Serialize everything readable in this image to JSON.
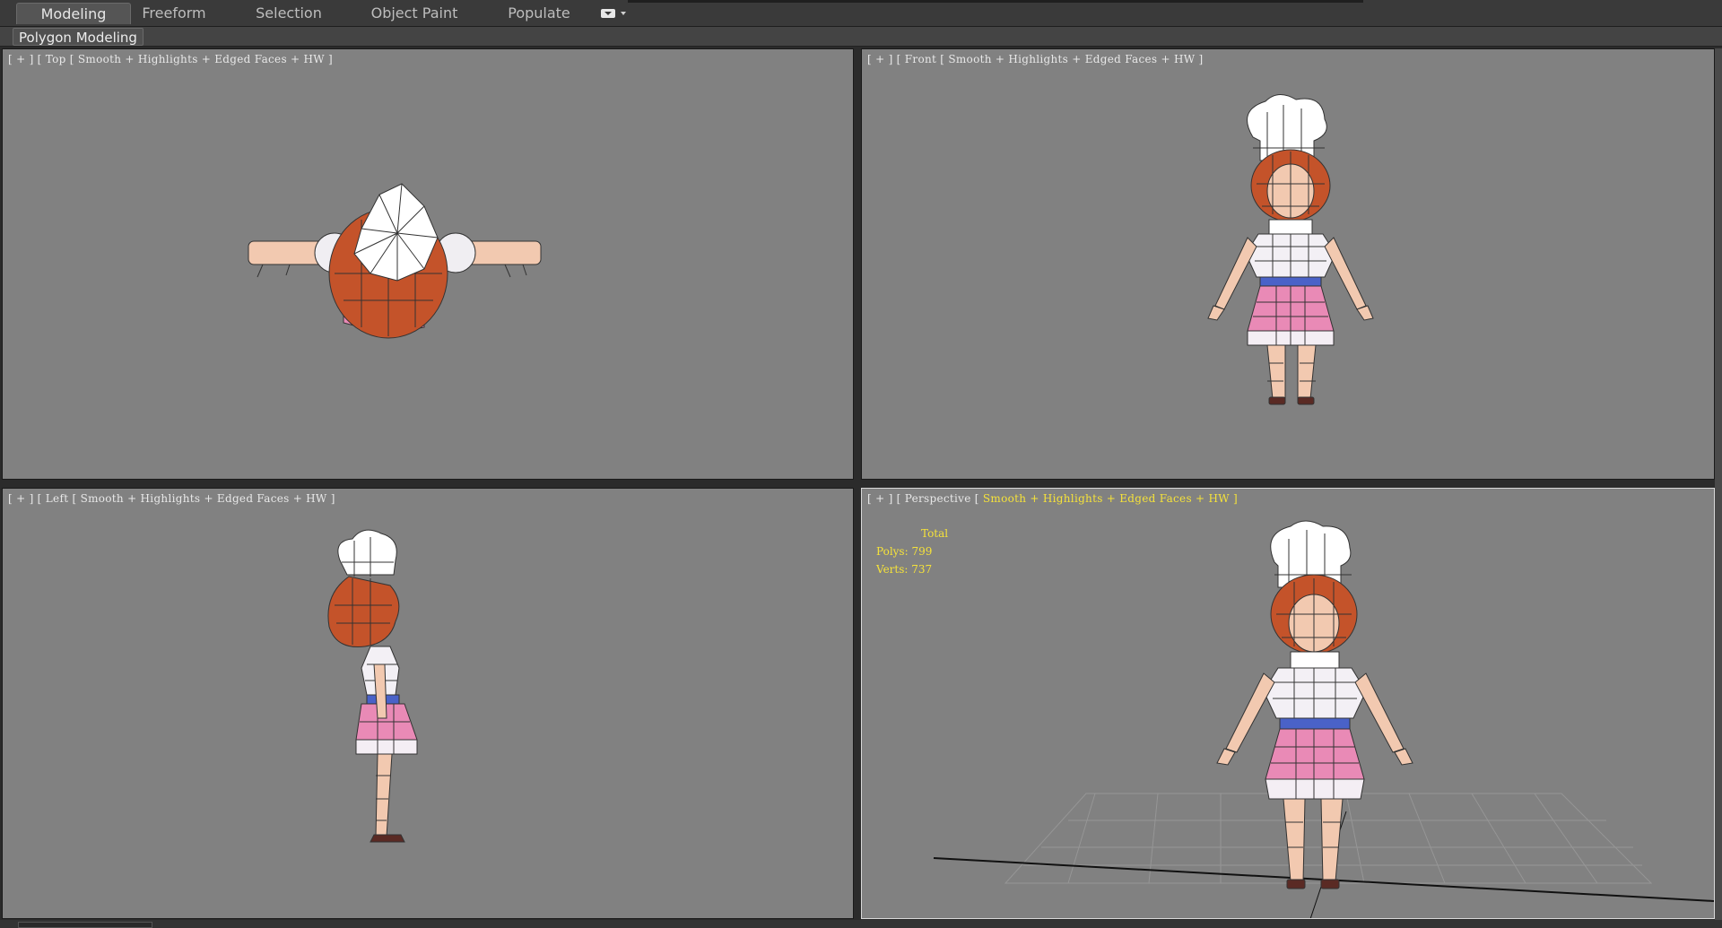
{
  "ribbon": {
    "tabs": [
      {
        "label": "Modeling"
      },
      {
        "label": "Freeform"
      },
      {
        "label": "Selection"
      },
      {
        "label": "Object Paint"
      },
      {
        "label": "Populate"
      }
    ],
    "active_tab": "Modeling",
    "panel_label": "Polygon Modeling"
  },
  "viewports": {
    "top": {
      "bracket": "[ + ]",
      "view": "Top",
      "mode": "Smooth + Highlights + Edged Faces + HW",
      "close": "]"
    },
    "front": {
      "bracket": "[ + ]",
      "view": "Front",
      "mode": "Smooth + Highlights + Edged Faces + HW",
      "close": "]"
    },
    "left": {
      "bracket": "[ + ]",
      "view": "Left",
      "mode": "Smooth + Highlights + Edged Faces + HW",
      "close": "]"
    },
    "perspective": {
      "bracket": "[ + ]",
      "view": "Perspective",
      "mode": "Smooth + Highlights + Edged Faces + HW",
      "close": "]"
    }
  },
  "stats": {
    "total_label": "Total",
    "polys": "Polys: 799",
    "verts": "Verts: 737"
  },
  "colors": {
    "viewport_bg": "#818181",
    "stats_text": "#f5e23a",
    "hair": "#c4532a",
    "apron_pink": "#e98ab6",
    "belt_blue": "#4a62c8",
    "skin": "#f2c9b0"
  },
  "icons": {
    "ribbon_options": "dropdown-box-icon"
  }
}
